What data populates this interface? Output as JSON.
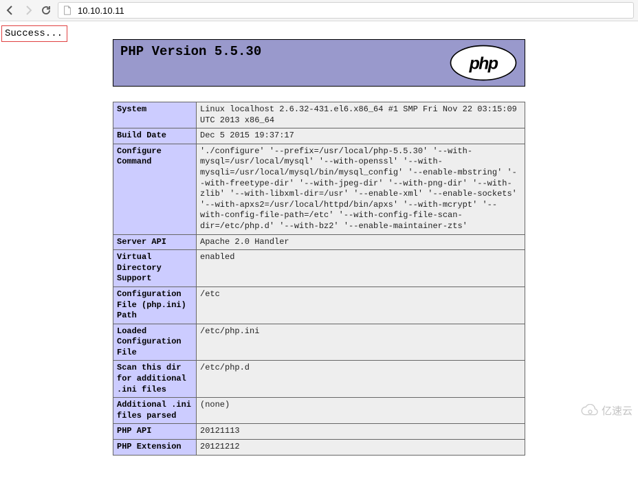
{
  "browser": {
    "url": "10.10.10.11"
  },
  "page": {
    "highlight_text": "Success...",
    "php_version_title": "PHP Version 5.5.30",
    "rows": [
      {
        "k": "System",
        "v": "Linux localhost 2.6.32-431.el6.x86_64 #1 SMP Fri Nov 22 03:15:09 UTC 2013 x86_64"
      },
      {
        "k": "Build Date",
        "v": "Dec 5 2015 19:37:17"
      },
      {
        "k": "Configure Command",
        "v": "'./configure' '--prefix=/usr/local/php-5.5.30' '--with-mysql=/usr/local/mysql' '--with-openssl' '--with-mysqli=/usr/local/mysql/bin/mysql_config' '--enable-mbstring' '--with-freetype-dir' '--with-jpeg-dir' '--with-png-dir' '--with-zlib' '--with-libxml-dir=/usr' '--enable-xml' '--enable-sockets' '--with-apxs2=/usr/local/httpd/bin/apxs' '--with-mcrypt' '--with-config-file-path=/etc' '--with-config-file-scan-dir=/etc/php.d' '--with-bz2' '--enable-maintainer-zts'"
      },
      {
        "k": "Server API",
        "v": "Apache 2.0 Handler"
      },
      {
        "k": "Virtual Directory Support",
        "v": "enabled"
      },
      {
        "k": "Configuration File (php.ini) Path",
        "v": "/etc"
      },
      {
        "k": "Loaded Configuration File",
        "v": "/etc/php.ini"
      },
      {
        "k": "Scan this dir for additional .ini files",
        "v": "/etc/php.d"
      },
      {
        "k": "Additional .ini files parsed",
        "v": "(none)"
      },
      {
        "k": "PHP API",
        "v": "20121113"
      },
      {
        "k": "PHP Extension",
        "v": "20121212"
      }
    ]
  },
  "watermark": {
    "text": "亿速云"
  }
}
